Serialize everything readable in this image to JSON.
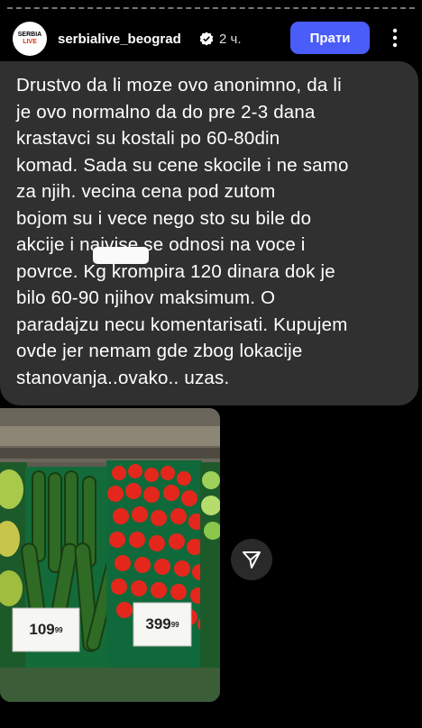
{
  "header": {
    "avatar_line1": "SERBIA",
    "avatar_line2": "LIVE",
    "username": "serbialive_beograd",
    "time": "2 ч.",
    "follow_label": "Прати"
  },
  "message": {
    "text": "Drustvo da li moze ovo anonimno, da li\nje ovo normalno da do pre 2-3 dana\nkrastavci su kostali po 60-80din\nkomad. Sada su cene skocile i ne samo\nza njih.          vecina cena pod zutom\nbojom su i vece nego sto su bile do\nakcije i najvise se odnosi na voce i\npovrce. Kg krompira 120 dinara dok je\nbilo 60-90 njihov maksimum. O\nparadajzu necu komentarisati. Kupujem\novde jer nemam gde zbog lokacije\nstanovanja..ovako.. uzas."
  },
  "photo": {
    "price_left": "109",
    "price_left_cents": "99",
    "price_right": "399",
    "price_right_cents": "99"
  },
  "colors": {
    "follow_button": "#4a5df8",
    "bubble": "#303030",
    "background": "#000000"
  }
}
